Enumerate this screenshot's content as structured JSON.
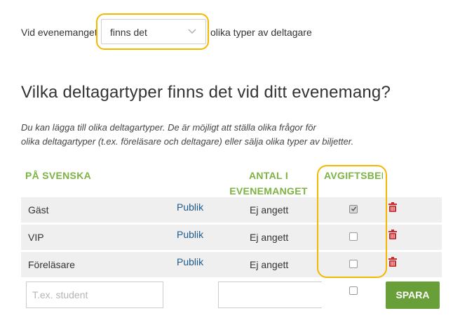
{
  "attendance": {
    "prefix": "Vid evenemanget",
    "select_value": "finns det",
    "suffix": "olika typer av deltagare"
  },
  "section": {
    "heading": "Vilka deltagartyper finns det vid ditt evenemang?",
    "help_line1": "Du kan lägga till olika deltagartyper. De är möjligt att ställa olika frågor för",
    "help_line2": "olika deltagartyper (t.ex. föreläsare och deltagare) eller sälja olika typer av biljetter."
  },
  "table": {
    "headers": {
      "name": "PÅ SVENSKA",
      "count": "ANTAL I EVENEMANGET",
      "fee": "AVGIFTSBELAGD"
    },
    "rows": [
      {
        "name": "Gäst",
        "link": "Publik",
        "count": "Ej angett",
        "fee_checked": true
      },
      {
        "name": "VIP",
        "link": "Publik",
        "count": "Ej angett",
        "fee_checked": false
      },
      {
        "name": "Föreläsare",
        "link": "Publik",
        "count": "Ej angett",
        "fee_checked": false
      }
    ]
  },
  "new_row": {
    "name_placeholder": "T.ex. student",
    "save_label": "SPARA"
  },
  "icons": {
    "select": "chevron-down-icon",
    "delete": "trash-icon",
    "check": "checkmark-icon"
  },
  "colors": {
    "accent_green": "#7cb342",
    "button_green": "#689f38",
    "link_blue": "#1e5a8a",
    "delete_red": "#cc2a2a",
    "highlight": "#f5b800"
  }
}
